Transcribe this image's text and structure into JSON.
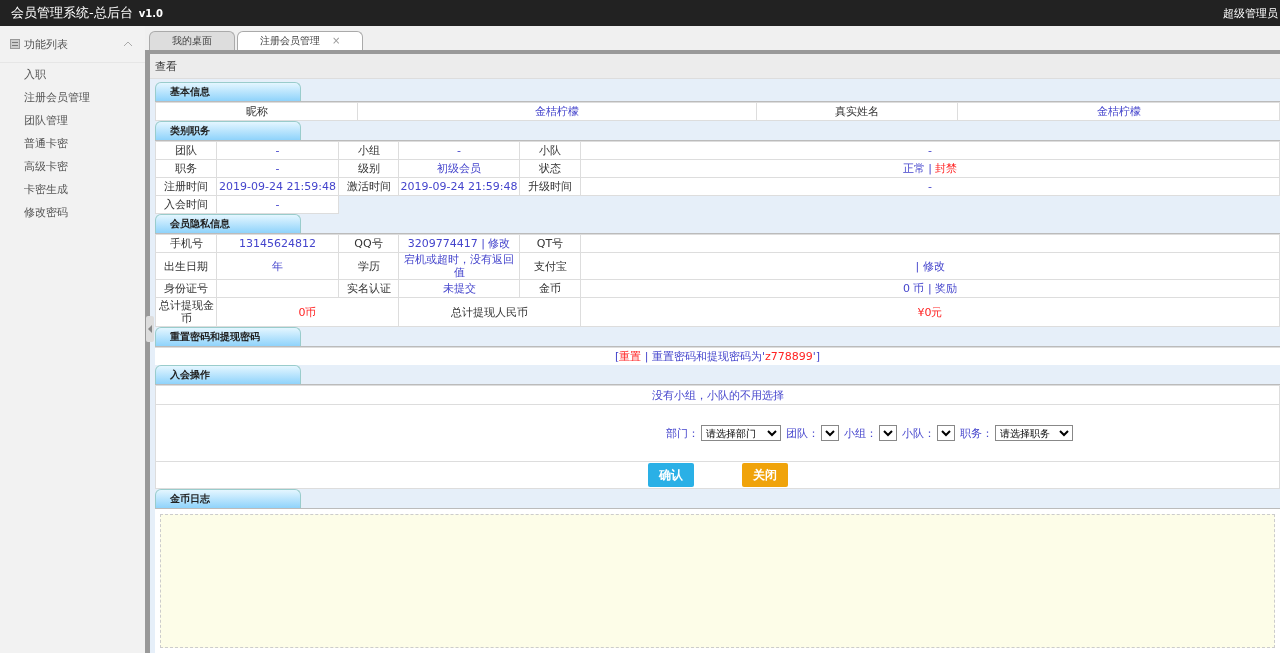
{
  "topbar": {
    "title": "会员管理系统-总后台",
    "version": "v1.0",
    "user": "超级管理员"
  },
  "sidebar": {
    "title": "功能列表",
    "expanded": true,
    "items": [
      {
        "label": "入职"
      },
      {
        "label": "注册会员管理"
      },
      {
        "label": "团队管理"
      },
      {
        "label": "普通卡密"
      },
      {
        "label": "高级卡密"
      },
      {
        "label": "卡密生成"
      },
      {
        "label": "修改密码"
      }
    ]
  },
  "tabs": [
    {
      "label": "我的桌面",
      "selected": false
    },
    {
      "label": "注册会员管理",
      "selected": true,
      "close": "×"
    }
  ],
  "panel_title": "查看",
  "sections": [
    {
      "title": "基本信息",
      "kind": "table",
      "rows": [
        [
          {
            "kind": "label",
            "text": "昵称"
          },
          {
            "kind": "value",
            "parts": [
              {
                "text": "金桔柠檬",
                "warning": false
              }
            ]
          },
          {
            "kind": "label",
            "text": "真实姓名"
          },
          {
            "kind": "value",
            "parts": [
              {
                "text": "金桔柠檬",
                "warning": false
              }
            ]
          }
        ]
      ]
    },
    {
      "title": "类别职务",
      "kind": "table",
      "rows": [
        [
          {
            "kind": "label",
            "text": "团队"
          },
          {
            "kind": "value",
            "parts": [
              {
                "text": "-",
                "warning": false
              }
            ]
          },
          {
            "kind": "label",
            "text": "小组"
          },
          {
            "kind": "value",
            "parts": [
              {
                "text": "-",
                "warning": false
              }
            ]
          },
          {
            "kind": "label",
            "text": "小队"
          },
          {
            "kind": "value",
            "parts": [
              {
                "text": "-",
                "warning": false
              }
            ]
          }
        ],
        [
          {
            "kind": "label",
            "text": "职务"
          },
          {
            "kind": "value",
            "parts": [
              {
                "text": "-",
                "warning": false
              }
            ]
          },
          {
            "kind": "label",
            "text": "级别"
          },
          {
            "kind": "value",
            "parts": [
              {
                "text": "初级会员",
                "warning": false
              }
            ]
          },
          {
            "kind": "label",
            "text": "状态"
          },
          {
            "kind": "value",
            "parts": [
              {
                "text": "正常",
                "warning": false
              },
              {
                "text": "|",
                "warning": false
              },
              {
                "text": "封禁",
                "warning": true
              }
            ]
          }
        ],
        [
          {
            "kind": "label",
            "text": "注册时间"
          },
          {
            "kind": "value",
            "parts": [
              {
                "text": "2019-09-24 21:59:48",
                "warning": false
              }
            ]
          },
          {
            "kind": "label",
            "text": "激活时间"
          },
          {
            "kind": "value",
            "parts": [
              {
                "text": "2019-09-24 21:59:48",
                "warning": false
              }
            ]
          },
          {
            "kind": "label",
            "text": "升级时间"
          },
          {
            "kind": "value",
            "parts": [
              {
                "text": "-",
                "warning": false
              }
            ]
          }
        ],
        [
          {
            "kind": "label",
            "text": "入会时间"
          },
          {
            "kind": "value",
            "parts": [
              {
                "text": "-",
                "warning": false
              }
            ]
          }
        ]
      ]
    },
    {
      "title": "会员隐私信息",
      "kind": "table",
      "rows": [
        [
          {
            "kind": "label",
            "text": "手机号"
          },
          {
            "kind": "value",
            "parts": [
              {
                "text": "13145624812",
                "warning": false
              }
            ]
          },
          {
            "kind": "label",
            "text": "QQ号"
          },
          {
            "kind": "value",
            "parts": [
              {
                "text": "3209774417",
                "warning": false
              },
              {
                "text": "|",
                "warning": false
              },
              {
                "text": "修改",
                "warning": false
              }
            ]
          },
          {
            "kind": "label",
            "text": "QT号"
          },
          {
            "kind": "value"
          }
        ],
        [
          {
            "kind": "label",
            "text": "出生日期"
          },
          {
            "kind": "value",
            "parts": [
              {
                "text": "年",
                "warning": false
              }
            ]
          },
          {
            "kind": "label",
            "text": "学历"
          },
          {
            "kind": "value",
            "parts": [
              {
                "text": "宕机或超时，没有返回值",
                "warning": false
              }
            ]
          },
          {
            "kind": "label",
            "text": "支付宝"
          },
          {
            "kind": "value",
            "parts": [
              {
                "text": "|",
                "warning": false
              },
              {
                "text": "修改",
                "warning": false
              }
            ]
          }
        ],
        [
          {
            "kind": "label",
            "text": "身份证号"
          },
          {
            "kind": "value"
          },
          {
            "kind": "label",
            "text": "实名认证"
          },
          {
            "kind": "value",
            "parts": [
              {
                "text": "未提交",
                "warning": false
              }
            ]
          },
          {
            "kind": "label",
            "text": "金币"
          },
          {
            "kind": "value",
            "parts": [
              {
                "text": "0 币",
                "warning": false
              },
              {
                "text": "|",
                "warning": false
              },
              {
                "text": "奖励",
                "warning": false
              }
            ]
          }
        ]
      ],
      "totals": [
        {
          "kind": "label",
          "text": "总计提现金币"
        },
        {
          "kind": "value",
          "parts": [
            {
              "text": "0币",
              "warning": true
            }
          ]
        },
        {
          "kind": "label",
          "text": "总计提现人民币"
        },
        {
          "kind": "value",
          "parts": [
            {
              "text": "¥0元",
              "warning": true
            }
          ]
        }
      ]
    },
    {
      "title": "重置密码和提现密码",
      "kind": "notice",
      "parts": [
        {
          "text": "[",
          "warning": false
        },
        {
          "text": "重置",
          "warning": true
        },
        {
          "text": "|",
          "warning": false
        },
        {
          "text": "重置密码和提现密码为'",
          "warning": false
        },
        {
          "text": "z778899",
          "warning": true
        },
        {
          "text": "']",
          "warning": false
        }
      ]
    },
    {
      "title": "入会操作",
      "kind": "form",
      "hint": "没有小组，小队的不用选择",
      "fields": [
        {
          "label": "部门：",
          "value": "请选择部门"
        },
        {
          "label": "团队："
        },
        {
          "label": "小组："
        },
        {
          "label": "小队："
        },
        {
          "label": "职务：",
          "value": "请选择职务"
        }
      ],
      "buttons": [
        {
          "label": "确认",
          "kind": "primary"
        },
        {
          "label": "关闭",
          "kind": "warning"
        }
      ]
    },
    {
      "title": "金币日志",
      "kind": "log"
    }
  ]
}
